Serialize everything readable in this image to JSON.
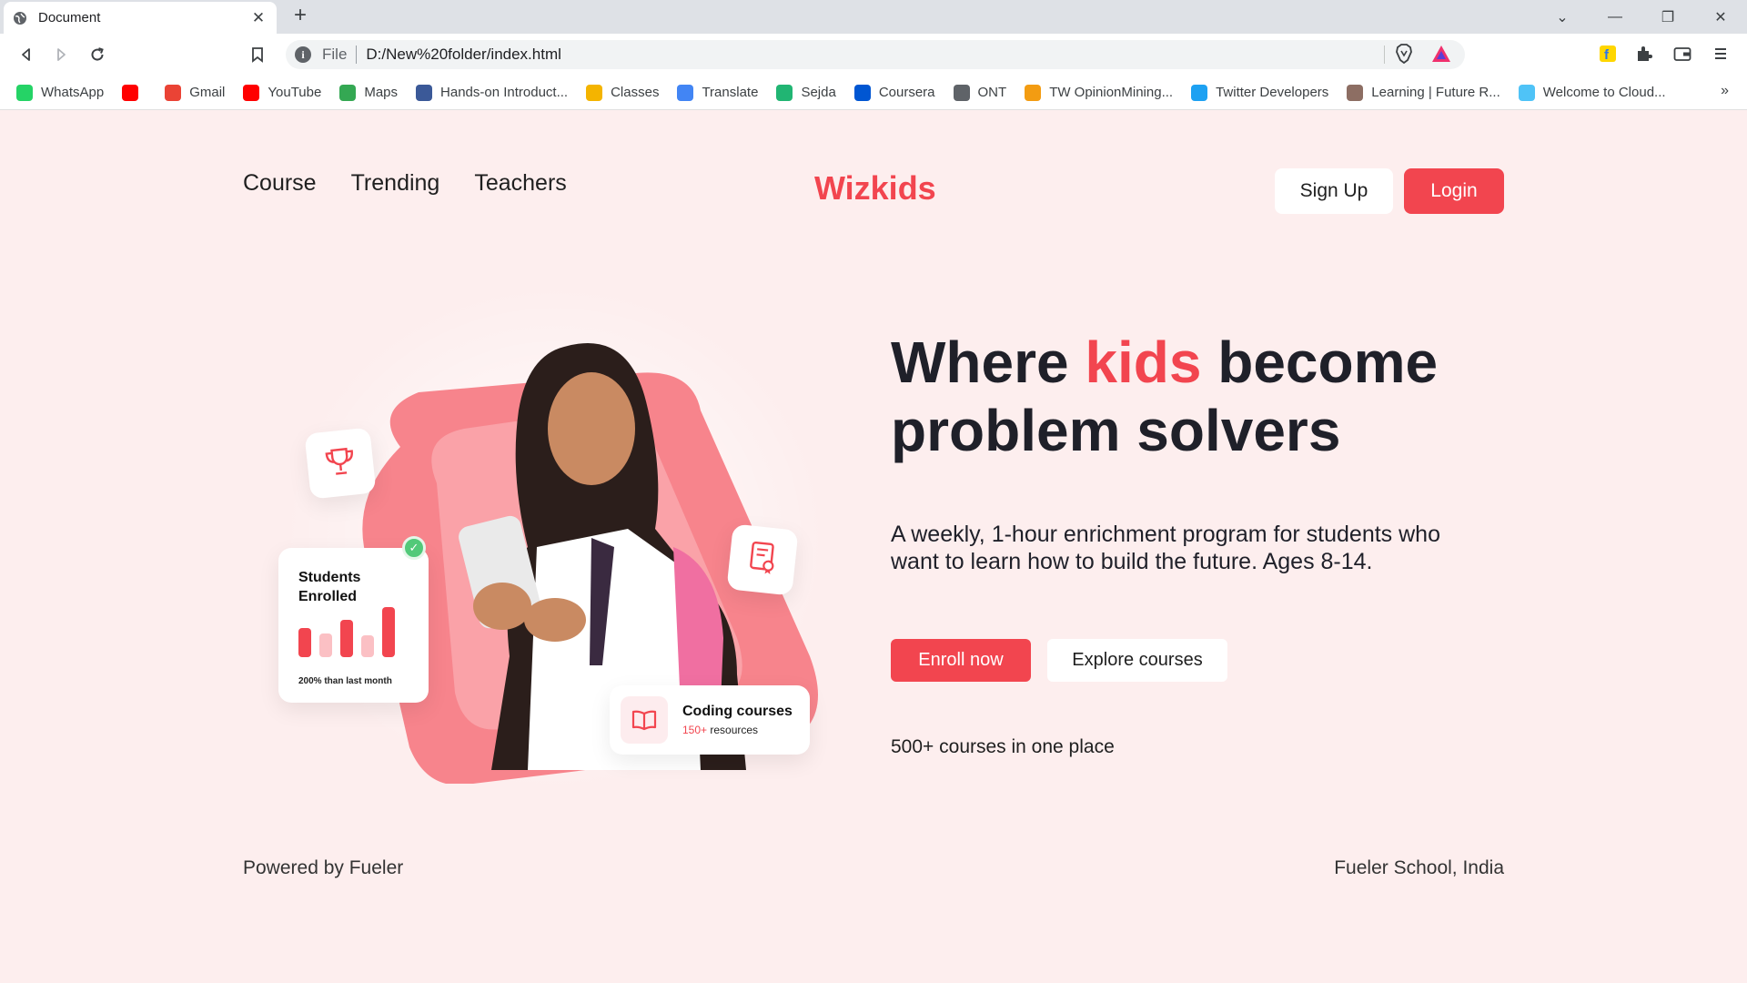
{
  "browser": {
    "tab_title": "Document",
    "new_tab": "+",
    "url_scheme": "File",
    "url": "D:/New%20folder/index.html",
    "bookmarks": [
      {
        "label": "WhatsApp",
        "icon": "whatsapp-icon",
        "color": "#25d366"
      },
      {
        "label": "",
        "icon": "youtube-icon",
        "color": "#ff0000"
      },
      {
        "label": "Gmail",
        "icon": "gmail-icon",
        "color": "#ea4335"
      },
      {
        "label": "YouTube",
        "icon": "youtube-icon",
        "color": "#ff0000"
      },
      {
        "label": "Maps",
        "icon": "maps-icon",
        "color": "#34a853"
      },
      {
        "label": "Hands-on Introduct...",
        "icon": "s-icon",
        "color": "#3b5998"
      },
      {
        "label": "Classes",
        "icon": "classroom-icon",
        "color": "#f4b400"
      },
      {
        "label": "Translate",
        "icon": "translate-icon",
        "color": "#4285f4"
      },
      {
        "label": "Sejda",
        "icon": "sejda-icon",
        "color": "#21b573"
      },
      {
        "label": "Coursera",
        "icon": "coursera-icon",
        "color": "#0056d2"
      },
      {
        "label": "ONT",
        "icon": "globe-icon",
        "color": "#5f6368"
      },
      {
        "label": "TW OpinionMining...",
        "icon": "co-icon",
        "color": "#f39c12"
      },
      {
        "label": "Twitter Developers",
        "icon": "twitter-icon",
        "color": "#1da1f2"
      },
      {
        "label": "Learning | Future R...",
        "icon": "learning-icon",
        "color": "#8d6e63"
      },
      {
        "label": "Welcome to Cloud...",
        "icon": "cloud-icon",
        "color": "#4fc3f7"
      }
    ],
    "more": "»"
  },
  "nav": {
    "links": [
      "Course",
      "Trending",
      "Teachers"
    ],
    "brand": "Wizkids",
    "signup": "Sign Up",
    "login": "Login"
  },
  "hero": {
    "title_pre": "Where ",
    "title_accent": "kids",
    "title_post": " become problem solvers",
    "subtitle": "A weekly, 1-hour enrichment program for students who want to learn how to build the future. Ages 8-14.",
    "enroll": "Enroll now",
    "explore": "Explore courses",
    "note": "500+ courses in one place"
  },
  "cards": {
    "students_title": "Students Enrolled",
    "students_foot": "200% than last month",
    "bar_levels": [
      0.55,
      0.45,
      0.7,
      0.42,
      0.95
    ],
    "coding_title": "Coding courses",
    "coding_count": "150+",
    "coding_suffix": " resources"
  },
  "footer": {
    "left": "Powered by Fueler",
    "right": "Fueler School, India"
  },
  "colors": {
    "accent": "#f2454f",
    "background": "#fdeeee"
  }
}
